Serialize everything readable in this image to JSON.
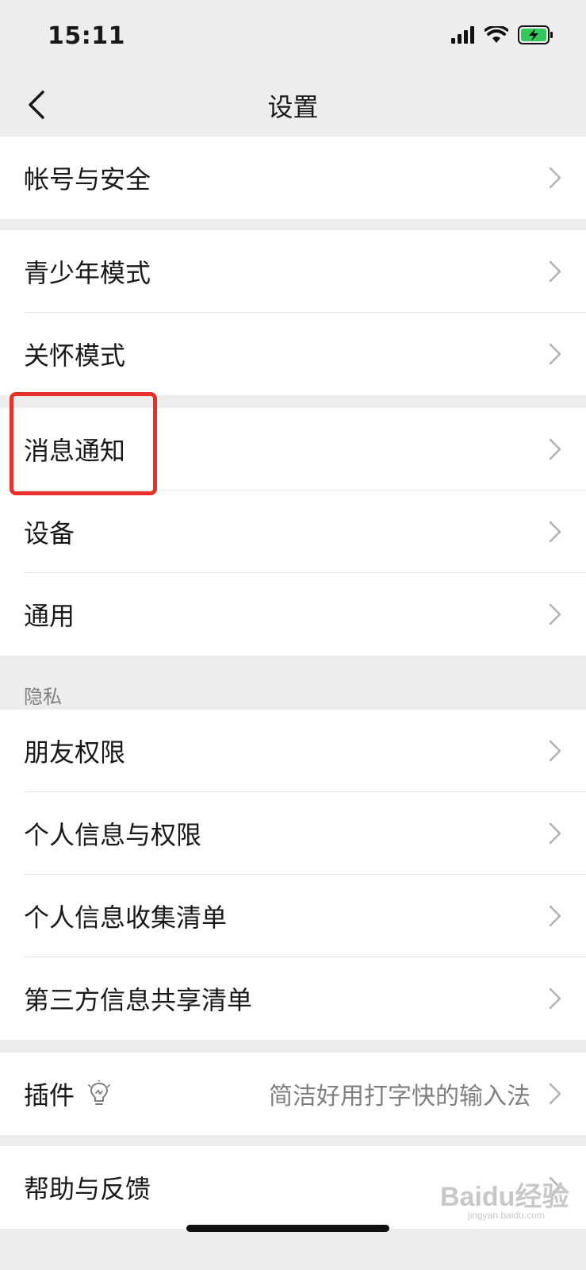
{
  "status_bar": {
    "time": "15:11"
  },
  "nav": {
    "title": "设置"
  },
  "groups": [
    {
      "items": [
        {
          "label": "帐号与安全"
        }
      ]
    },
    {
      "items": [
        {
          "label": "青少年模式"
        },
        {
          "label": "关怀模式"
        }
      ]
    },
    {
      "items": [
        {
          "label": "消息通知"
        },
        {
          "label": "设备"
        },
        {
          "label": "通用"
        }
      ]
    },
    {
      "section_title": "隐私",
      "items": [
        {
          "label": "朋友权限"
        },
        {
          "label": "个人信息与权限"
        },
        {
          "label": "个人信息收集清单"
        },
        {
          "label": "第三方信息共享清单"
        }
      ]
    },
    {
      "items": [
        {
          "label": "插件",
          "value": "简洁好用打字快的输入法"
        }
      ]
    },
    {
      "items": [
        {
          "label": "帮助与反馈"
        }
      ]
    }
  ],
  "watermark": {
    "brand": "Baidu经验",
    "url": "jingyan.baidu.com"
  },
  "colors": {
    "background": "#ededed",
    "card": "#ffffff",
    "highlight": "#e8312a",
    "battery": "#34c759"
  }
}
